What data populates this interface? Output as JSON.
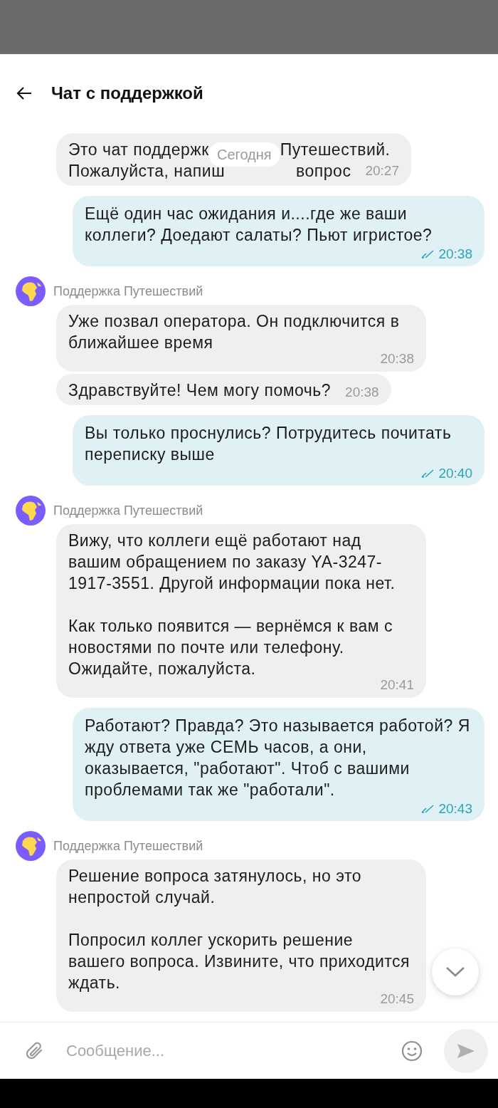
{
  "header": {
    "title": "Чат с поддержкой"
  },
  "date_label": "Сегодня",
  "messages": [
    {
      "kind": "incoming",
      "covered_lines": [
        [
          "Это чат поддержк",
          "Путешествий."
        ],
        [
          "Пожалуйста, напиш",
          "вопрос"
        ]
      ],
      "time": "20:27"
    },
    {
      "kind": "outgoing",
      "paragraphs": [
        "Ещё один час ожидания и....где же ваши коллеги? Доедают салаты? Пьют игристое?"
      ],
      "time": "20:38",
      "read": true
    },
    {
      "kind": "incoming",
      "sender": "Поддержка Путешествий",
      "paragraphs": [
        "Уже позвал оператора. Он подключится в ближайшее время"
      ],
      "time": "20:38"
    },
    {
      "kind": "incoming",
      "paragraphs": [
        "Здравствуйте! Чем могу помочь?"
      ],
      "time": "20:38"
    },
    {
      "kind": "outgoing",
      "paragraphs": [
        "Вы только проснулись? Потрудитесь почитать переписку выше"
      ],
      "time": "20:40",
      "read": true
    },
    {
      "kind": "incoming",
      "sender": "Поддержка Путешествий",
      "paragraphs": [
        "Вижу, что коллеги ещё работают над вашим обращением по заказу YA-3247-1917-3551. Другой информации пока нет.",
        "Как только появится — вернёмся к вам с новостями по почте или телефону. Ожидайте, пожалуйста."
      ],
      "time": "20:41"
    },
    {
      "kind": "outgoing",
      "paragraphs": [
        "Работают? Правда? Это называется работой? Я жду ответа уже СЕМЬ часов, а они, оказывается, \"работают\". Чтоб с вашими проблемами так же \"работали\"."
      ],
      "time": "20:43",
      "read": true
    },
    {
      "kind": "incoming",
      "sender": "Поддержка Путешествий",
      "paragraphs": [
        "Решение вопроса затянулось, но это непростой случай.",
        "Попросил коллег ускорить решение вашего вопроса. Извините, что приходится ждать."
      ],
      "time": "20:45"
    }
  ],
  "composer": {
    "placeholder": "Сообщение..."
  }
}
